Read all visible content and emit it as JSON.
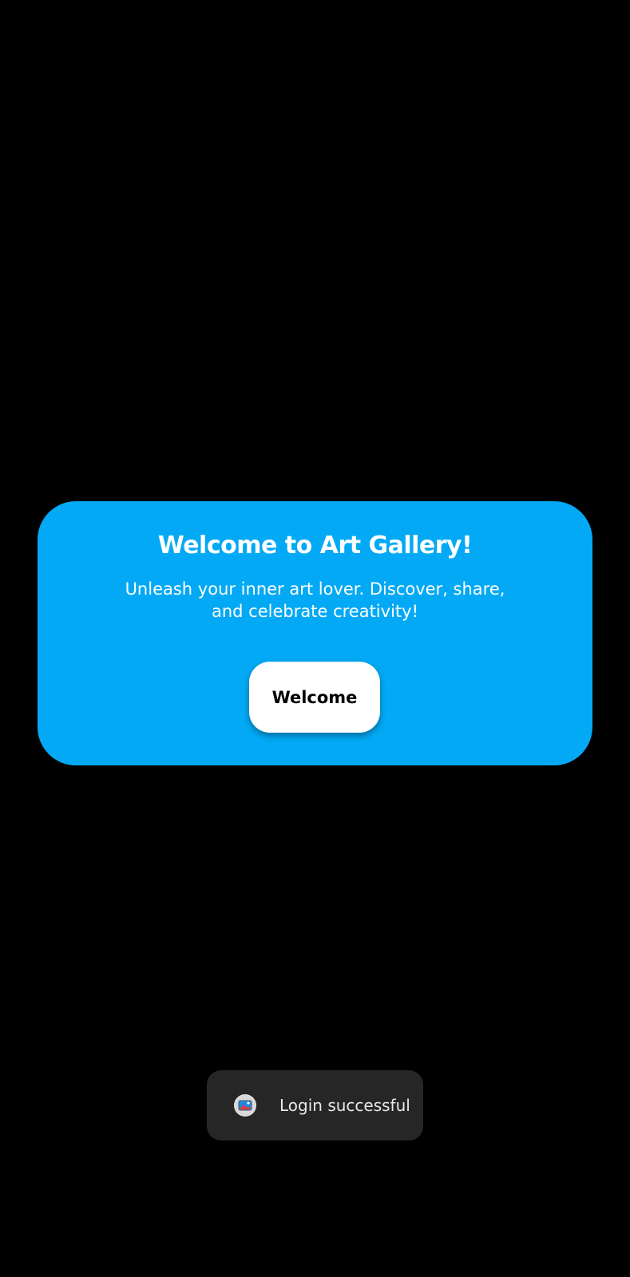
{
  "welcome_card": {
    "title": "Welcome to Art Gallery!",
    "subtitle": "Unleash your inner art lover. Discover, share, and celebrate creativity!",
    "button_label": "Welcome",
    "background_color": "#03A9F4"
  },
  "toast": {
    "icon": "app-gallery-icon",
    "message": "Login successful"
  }
}
